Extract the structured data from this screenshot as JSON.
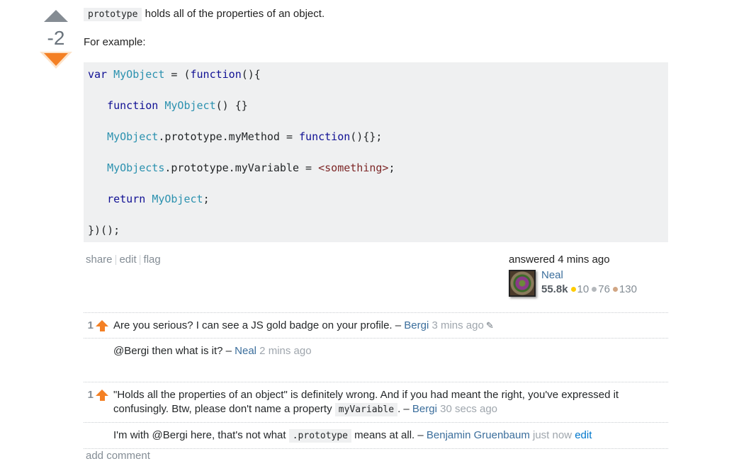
{
  "vote": {
    "count": "-2",
    "state": "downvoted"
  },
  "post": {
    "intro_code": "prototype",
    "intro_text": " holds all of the properties of an object.",
    "p2": "For example:",
    "code_lines": [
      [
        {
          "t": "kw",
          "v": "var "
        },
        {
          "t": "id",
          "v": "MyObject"
        },
        {
          "t": "pl",
          "v": " = ("
        },
        {
          "t": "kw",
          "v": "function"
        },
        {
          "t": "pl",
          "v": "(){"
        }
      ],
      [
        {
          "t": "pl",
          "v": "   "
        },
        {
          "t": "kw",
          "v": "function "
        },
        {
          "t": "id",
          "v": "MyObject"
        },
        {
          "t": "pl",
          "v": "() {}"
        }
      ],
      [
        {
          "t": "pl",
          "v": "   "
        },
        {
          "t": "id",
          "v": "MyObject"
        },
        {
          "t": "pl",
          "v": ".prototype.myMethod = "
        },
        {
          "t": "kw",
          "v": "function"
        },
        {
          "t": "pl",
          "v": "(){};"
        }
      ],
      [
        {
          "t": "pl",
          "v": "   "
        },
        {
          "t": "id",
          "v": "MyObjects"
        },
        {
          "t": "pl",
          "v": ".prototype.myVariable = "
        },
        {
          "t": "str",
          "v": "<something>"
        },
        {
          "t": "pl",
          "v": ";"
        }
      ],
      [
        {
          "t": "pl",
          "v": "   "
        },
        {
          "t": "kw",
          "v": "return "
        },
        {
          "t": "id",
          "v": "MyObject"
        },
        {
          "t": "pl",
          "v": ";"
        }
      ],
      [
        {
          "t": "pl",
          "v": "})();"
        }
      ]
    ]
  },
  "menu": {
    "share": "share",
    "edit": "edit",
    "flag": "flag",
    "sep": "|"
  },
  "signature": {
    "action": "answered 4 mins ago",
    "user": "Neal",
    "reputation": "55.8k",
    "gold": "10",
    "silver": "76",
    "bronze": "130"
  },
  "comments": [
    {
      "score": "1",
      "text": "Are you serious? I can see a JS gold badge on your profile. – ",
      "user": "Bergi",
      "date": " 3 mins ago",
      "edited": true
    },
    {
      "score": "",
      "text": "@Bergi then what is it? – ",
      "user": "Neal",
      "date": " 2 mins ago"
    },
    {
      "score": "1",
      "text_a": "\"Holds all the properties of an object\" is definitely wrong. And if you had meant the right, you've expressed it confusingly. Btw, please don't name a property ",
      "code": "myVariable",
      "text_b": ". – ",
      "user": "Bergi",
      "date": " 30 secs ago"
    },
    {
      "score": "",
      "text_a": "I'm with @Bergi here, that's not what ",
      "code": ".prototype",
      "text_b": " means at all. – ",
      "user": "Benjamin Gruenbaum",
      "date": " just now ",
      "edit_link": "edit"
    }
  ],
  "add_comment": "add comment"
}
